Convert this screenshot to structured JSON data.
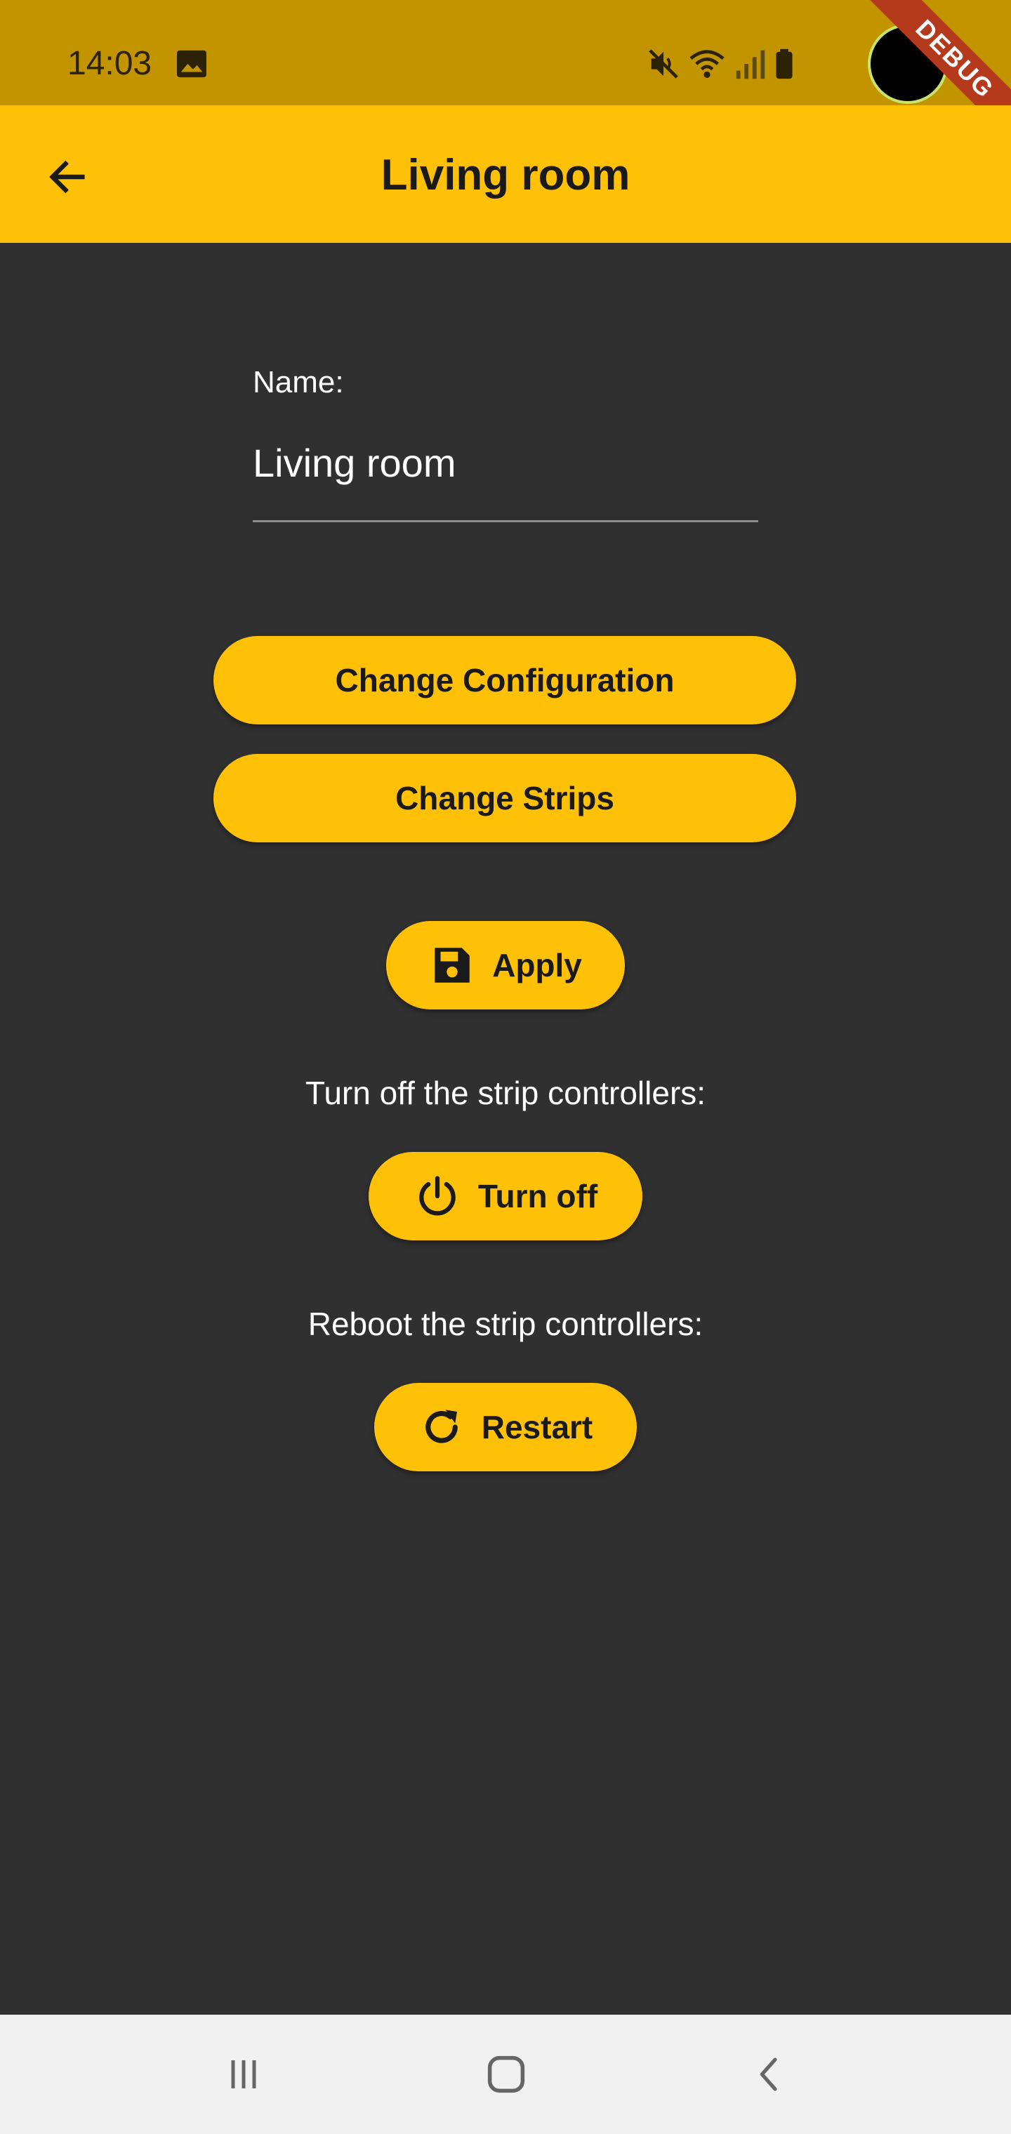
{
  "status_bar": {
    "time": "14:03",
    "icons": [
      "image-icon",
      "mute-icon",
      "wifi-icon",
      "signal-icon",
      "battery-icon"
    ],
    "debug_banner": "DEBUG"
  },
  "app_bar": {
    "title": "Living room",
    "back_icon": "arrow-left-icon"
  },
  "form": {
    "name_label": "Name:",
    "name_value": "Living room"
  },
  "buttons": {
    "change_configuration": "Change Configuration",
    "change_strips": "Change Strips",
    "apply": "Apply",
    "turn_off": "Turn off",
    "restart": "Restart"
  },
  "captions": {
    "turn_off": "Turn off the strip controllers:",
    "reboot": "Reboot the strip controllers:"
  },
  "nav_bar": {
    "icons": [
      "recent-apps-icon",
      "home-icon",
      "back-icon"
    ]
  },
  "colors": {
    "accent": "#ffc107",
    "status_bar": "#c29500",
    "background": "#303030",
    "nav_bar": "#f1f1f1"
  }
}
